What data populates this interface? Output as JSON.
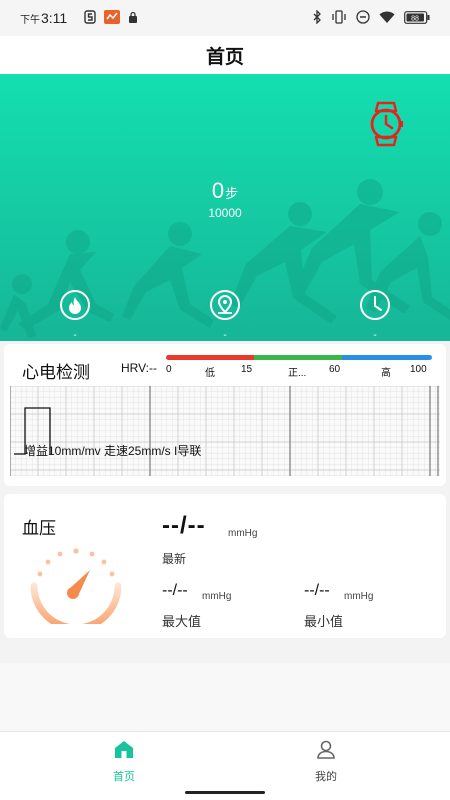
{
  "status_bar": {
    "time_prefix": "下午",
    "time": "3:11",
    "battery": "88"
  },
  "header": {
    "title": "首页"
  },
  "hero": {
    "steps_value": "0",
    "steps_unit": "步",
    "steps_goal": "10000",
    "stats": [
      {
        "icon": "flame-icon",
        "value": "-"
      },
      {
        "icon": "location-pin-icon",
        "value": "-"
      },
      {
        "icon": "clock-icon",
        "value": "-"
      }
    ]
  },
  "ecg": {
    "title": "心电检测",
    "hrv_label": "HRV:--",
    "scale_ticks": [
      "0",
      "低",
      "15",
      "正...",
      "60",
      "高",
      "100"
    ],
    "scale_colors": [
      "#e8392a",
      "#3cb64a",
      "#2b8fe6"
    ],
    "note": "增益10mm/mv 走速25mm/s I导联"
  },
  "blood_pressure": {
    "title": "血压",
    "latest_value": "--/--",
    "latest_unit": "mmHg",
    "latest_label": "最新",
    "max_value": "--/--",
    "max_unit": "mmHg",
    "max_label": "最大值",
    "min_value": "--/--",
    "min_unit": "mmHg",
    "min_label": "最小值"
  },
  "tabs": [
    {
      "label": "首页",
      "icon": "home-icon",
      "active": true
    },
    {
      "label": "我的",
      "icon": "user-icon",
      "active": false
    }
  ],
  "colors": {
    "accent": "#17c49c",
    "watch_icon": "#e5231f",
    "gauge": "#f7a06a"
  }
}
